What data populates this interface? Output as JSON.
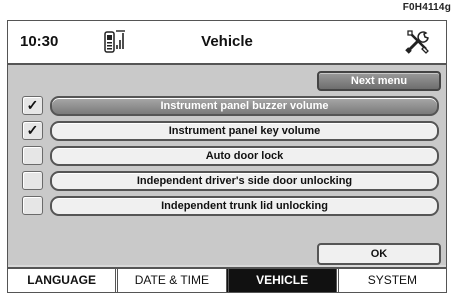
{
  "figure_code": "F0H4114g",
  "status": {
    "time": "10:30",
    "title": "Vehicle",
    "left_icon": "phone-signal-icon",
    "right_icon": "tools-icon"
  },
  "next_menu_label": "Next menu",
  "options": [
    {
      "label": "Instrument panel buzzer volume",
      "checked": true,
      "text": "✓"
    },
    {
      "label": "Instrument panel key volume",
      "checked": true,
      "text": "✓"
    },
    {
      "label": "Auto door lock",
      "checked": false,
      "text": ""
    },
    {
      "label": "Independent driver's side door unlocking",
      "checked": false,
      "text": ""
    },
    {
      "label": "Independent trunk lid unlocking",
      "checked": false,
      "text": ""
    }
  ],
  "ok_label": "OK",
  "tabs": [
    {
      "label": "LANGUAGE",
      "active": false
    },
    {
      "label": "DATE & TIME",
      "active": false
    },
    {
      "label": "VEHICLE",
      "active": true
    },
    {
      "label": "SYSTEM",
      "active": false
    }
  ]
}
